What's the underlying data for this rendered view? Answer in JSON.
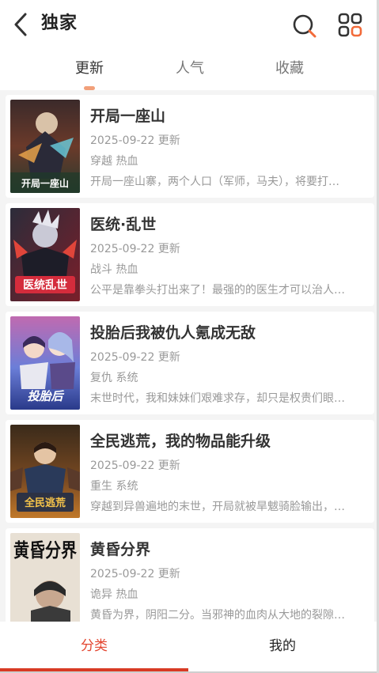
{
  "header": {
    "title": "独家",
    "accent_color": "#f26b3a"
  },
  "tabs": [
    {
      "label": "更新",
      "active": true
    },
    {
      "label": "人气",
      "active": false
    },
    {
      "label": "收藏",
      "active": false
    }
  ],
  "comics": [
    {
      "title": "开局一座山",
      "date": "2025-09-22 更新",
      "tags": "穿越 热血",
      "desc": "开局一座山寨，两个人口（军师，马夫），将要打…",
      "cover_text": "开局一座山"
    },
    {
      "title": "医统·乱世",
      "date": "2025-09-22 更新",
      "tags": "战斗 热血",
      "desc": "公平是靠拳头打出来了！最强的的医生才可以治人…",
      "cover_text": "医统乱世"
    },
    {
      "title": "投胎后我被仇人氪成无敌",
      "date": "2025-09-22 更新",
      "tags": "复仇 系统",
      "desc": "末世时代，我和妹妹们艰难求存，却只是权贵们眼…",
      "cover_text": "投胎后"
    },
    {
      "title": "全民逃荒，我的物品能升级",
      "date": "2025-09-22 更新",
      "tags": "重生 系统",
      "desc": "穿越到异兽遍地的末世，开局就被旱魃骑脸输出，…",
      "cover_text": "全民逃荒"
    },
    {
      "title": "黄昏分界",
      "date": "2025-09-22 更新",
      "tags": "诡异 热血",
      "desc": "黄昏为界，阴阳二分。当邪神的血肉从大地的裂隙…",
      "cover_text": "黄昏分界"
    }
  ],
  "bottom_nav": [
    {
      "label": "分类",
      "active": true
    },
    {
      "label": "我的",
      "active": false
    }
  ],
  "colors": {
    "active_red": "#e3452f",
    "tab_indicator": "#f2a07a"
  }
}
